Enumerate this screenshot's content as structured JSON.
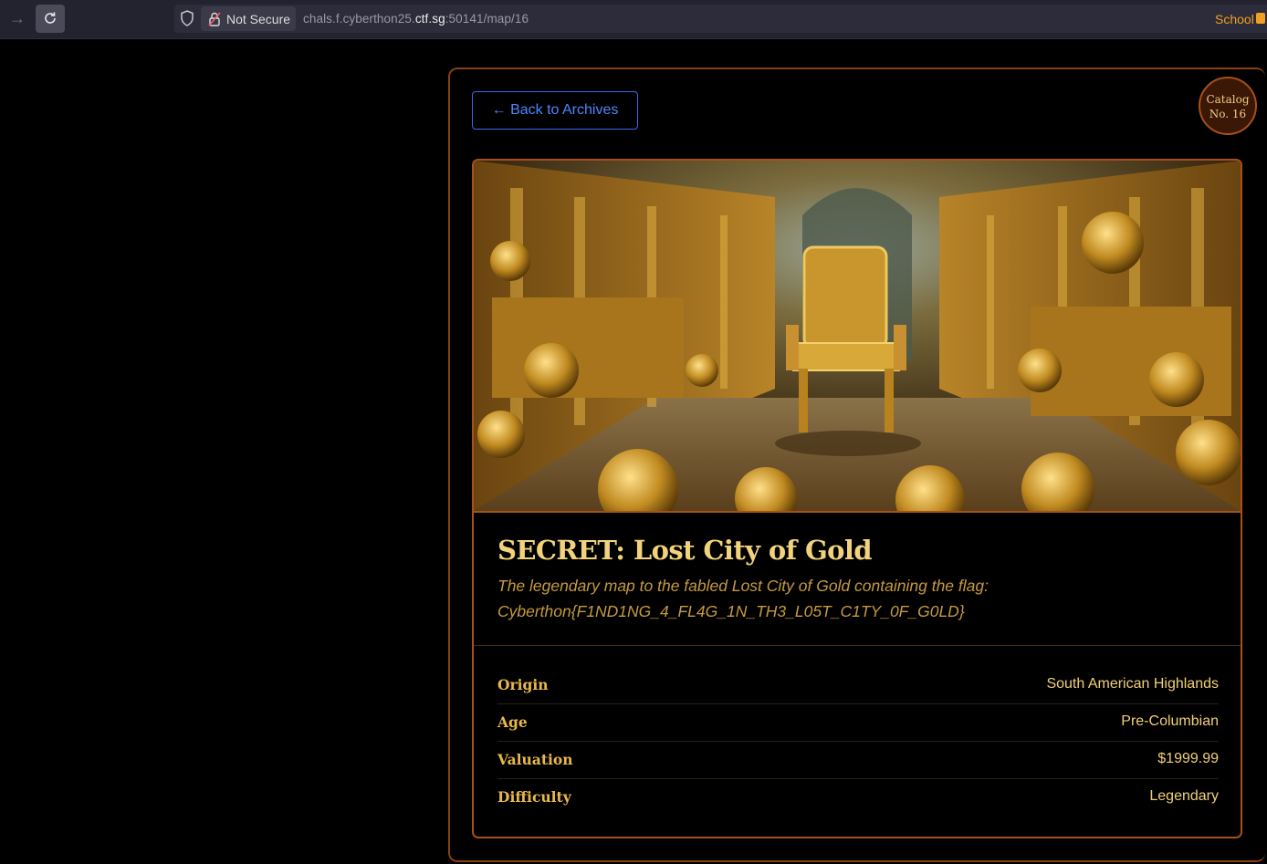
{
  "browser": {
    "security_label": "Not Secure",
    "url_prefix": "chals.f.cyberthon25.",
    "url_host": "ctf.sg",
    "url_suffix": ":50141/map/16",
    "bookmark_label": "School"
  },
  "page": {
    "back_label": "← Back to Archives",
    "catalog_line1": "Catalog",
    "catalog_line2": "No. 16",
    "title": "SECRET: Lost City of Gold",
    "description": "The legendary map to the fabled Lost City of Gold containing the flag: Cyberthon{F1ND1NG_4_FL4G_1N_TH3_L05T_C1TY_0F_G0LD}",
    "details": [
      {
        "label": "Origin",
        "value": "South American Highlands"
      },
      {
        "label": "Age",
        "value": "Pre-Columbian"
      },
      {
        "label": "Valuation",
        "value": "$1999.99"
      },
      {
        "label": "Difficulty",
        "value": "Legendary"
      }
    ]
  },
  "colors": {
    "accent_border": "#a8501a",
    "title_gold": "#f3d27c",
    "link_blue": "#4d86ff"
  }
}
